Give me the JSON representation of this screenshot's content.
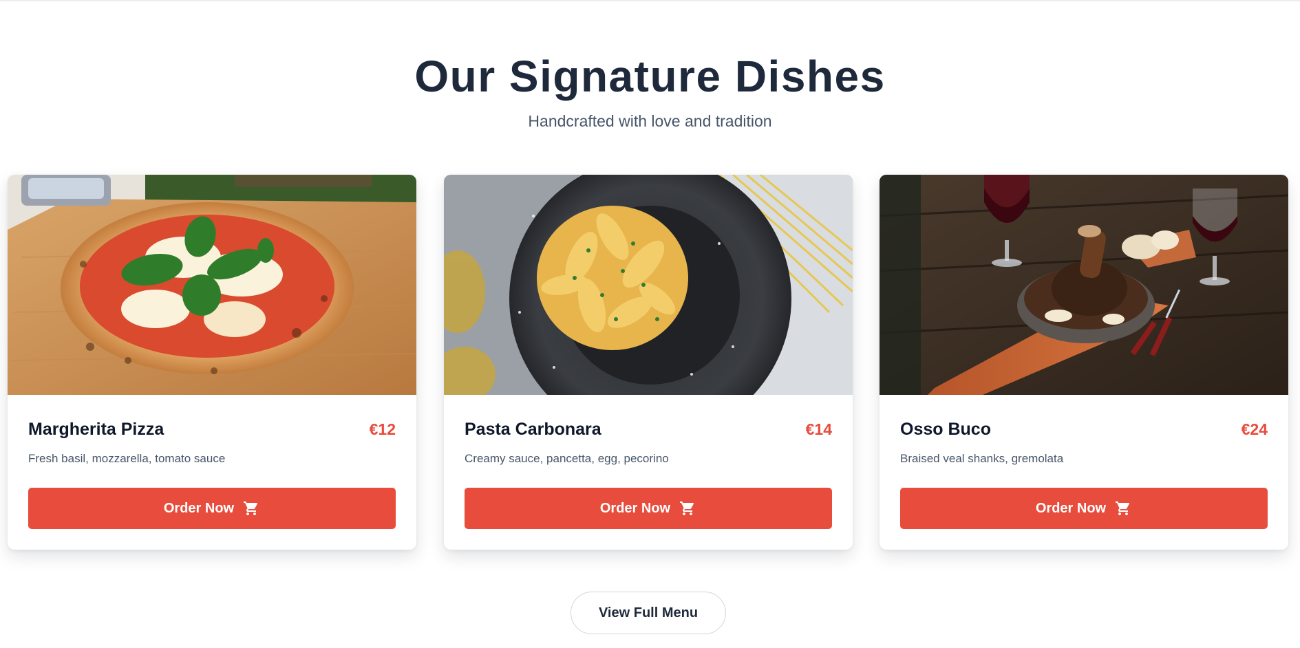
{
  "header": {
    "title": "Our Signature Dishes",
    "subtitle": "Handcrafted with love and tradition"
  },
  "dishes": [
    {
      "name": "Margherita Pizza",
      "price": "€12",
      "description": "Fresh basil, mozzarella, tomato sauce",
      "order_label": "Order Now",
      "image": "margherita-pizza-photo"
    },
    {
      "name": "Pasta Carbonara",
      "price": "€14",
      "description": "Creamy sauce, pancetta, egg, pecorino",
      "order_label": "Order Now",
      "image": "pasta-carbonara-photo"
    },
    {
      "name": "Osso Buco",
      "price": "€24",
      "description": "Braised veal shanks, gremolata",
      "order_label": "Order Now",
      "image": "osso-buco-photo"
    }
  ],
  "footer": {
    "view_menu_label": "View Full Menu"
  },
  "colors": {
    "accent": "#e74c3c",
    "heading": "#1e293b",
    "muted": "#475569"
  },
  "icons": {
    "order_button": "cart-icon"
  }
}
